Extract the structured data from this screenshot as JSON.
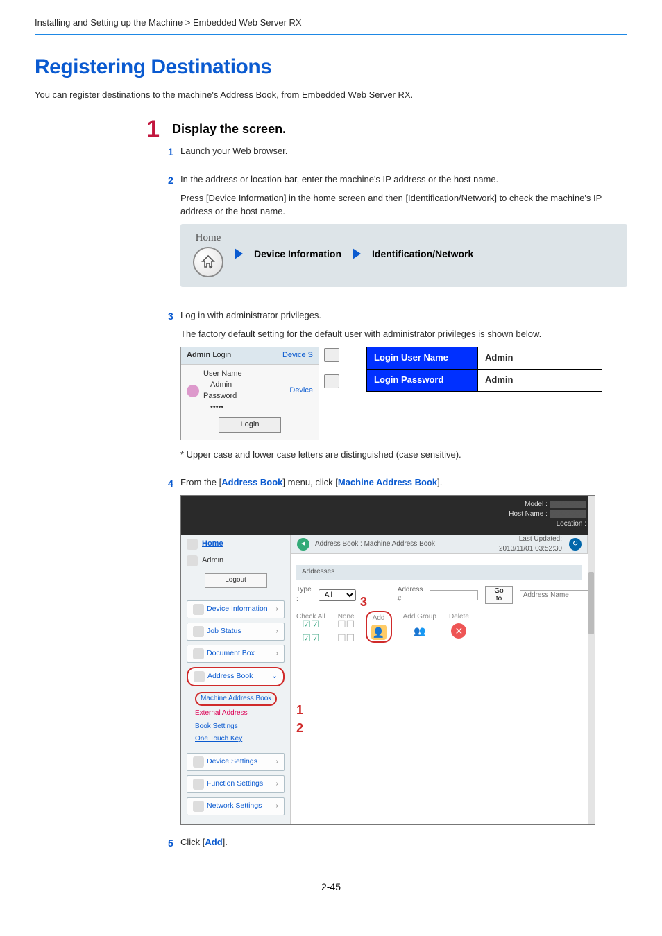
{
  "breadcrumb": "Installing and Setting up the Machine > Embedded Web Server RX",
  "heading": "Registering Destinations",
  "intro": "You can register destinations to the machine's Address Book, from Embedded Web Server RX.",
  "step1": {
    "num": "1",
    "title": "Display the screen.",
    "sub1_num": "1",
    "sub1_text": "Launch your Web browser.",
    "sub2_num": "2",
    "sub2_text": "In the address or location bar, enter the machine's IP address or the host name.",
    "sub2_note": "Press [Device Information] in the home screen and then [Identification/Network] to check the machine's IP address or the host name.",
    "home_label": "Home",
    "panel_item1": "Device Information",
    "panel_item2": "Identification/Network",
    "sub3_num": "3",
    "sub3_text": "Log in with administrator privileges.",
    "sub3_note": "The factory default setting for the default user with administrator privileges is shown below.",
    "admin_login": {
      "title_left": "Admin Login",
      "title_right": "Device S",
      "right_sub": "Device",
      "user_label": "User Name",
      "user_value": "Admin",
      "pass_label": "Password",
      "pass_value": "•••••",
      "login_btn": "Login"
    },
    "cred_table": {
      "row1k": "Login User Name",
      "row1v": "Admin",
      "row2k": "Login Password",
      "row2v": "Admin"
    },
    "case_note": "* Upper case and lower case letters are distinguished (case sensitive).",
    "sub4_num": "4",
    "sub4_pre": "From the [",
    "sub4_link1": "Address Book",
    "sub4_mid": "] menu, click [",
    "sub4_link2": "Machine Address Book",
    "sub4_post": "].",
    "sub5_num": "5",
    "sub5_pre": "Click [",
    "sub5_link": "Add",
    "sub5_post": "]."
  },
  "ews": {
    "model": "Model :",
    "host": "Host Name :",
    "loc": "Location :",
    "nav_home": "Home",
    "nav_admin": "Admin",
    "logout": "Logout",
    "menu_devinfo": "Device Information",
    "menu_jobstatus": "Job Status",
    "menu_docbox": "Document Box",
    "menu_addrbook": "Address Book",
    "sn_machine": "Machine Address Book",
    "sn_ext1": "External Address",
    "sn_ext2": "Book Settings",
    "sn_onetouch": "One Touch Key",
    "menu_devset": "Device Settings",
    "menu_funcset": "Function Settings",
    "menu_netset": "Network Settings",
    "crumb": "Address Book : Machine Address Book",
    "last_updated_l": "Last Updated:",
    "last_updated_v": "2013/11/01 03:52:30",
    "section_addresses": "Addresses",
    "type_label": "Type :",
    "type_value": "All",
    "addrnum": "Address #",
    "goto": "Go to",
    "addrname_ph": "Address Name",
    "act_checkall": "Check All",
    "act_none": "None",
    "act_add": "Add",
    "act_addgroup": "Add Group",
    "act_delete": "Delete",
    "callout1": "1",
    "callout2": "2",
    "callout3": "3"
  },
  "page_num": "2-45"
}
